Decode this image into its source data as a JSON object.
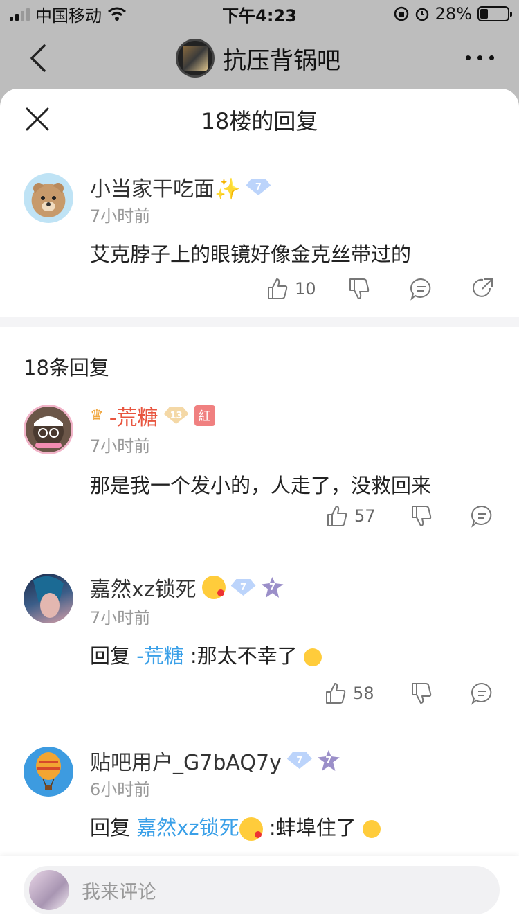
{
  "status_bar": {
    "carrier": "中国移动",
    "time": "下午4:23",
    "battery": "28%",
    "battery_level": 0.28,
    "icons": [
      "signal-icon",
      "wifi-icon",
      "rotation-lock-icon",
      "alarm-icon",
      "battery-icon"
    ]
  },
  "nav": {
    "title": "抗压背锅吧",
    "back_icon": "chevron-left-icon",
    "more_icon": "more-dots-icon"
  },
  "sheet": {
    "title": "18楼的回复",
    "close_icon": "close-icon"
  },
  "main_post": {
    "username": "小当家干吃面✨",
    "level": "7",
    "time": "7小时前",
    "content": "艾克脖子上的眼镜好像金克丝带过的",
    "like_count": "10",
    "icons": [
      "thumb-up-icon",
      "thumb-down-icon",
      "comment-icon",
      "share-icon"
    ]
  },
  "replies_header": "18条回复",
  "replies": [
    {
      "username": "-荒糖",
      "level": "13",
      "badge": "紅",
      "time": "7小时前",
      "content": "那是我一个发小的，人走了，没救回来",
      "like_count": "57"
    },
    {
      "username": "嘉然xz锁死",
      "level": "7",
      "level2": "7",
      "time": "7小时前",
      "reply_prefix": "回复 ",
      "mention": "-荒糖",
      "content": " :那太不幸了",
      "like_count": "58"
    },
    {
      "username": "贴吧用户_G7bAQ7y",
      "level": "7",
      "level2": "7",
      "time": "6小时前",
      "reply_prefix": "回复 ",
      "mention": "嘉然xz锁死",
      "content": " :蚌埠住了"
    }
  ],
  "bottom": {
    "placeholder": "我来评论"
  },
  "colors": {
    "mention": "#3aa0e8",
    "vip_name": "#e8553f",
    "meta": "#999999"
  }
}
